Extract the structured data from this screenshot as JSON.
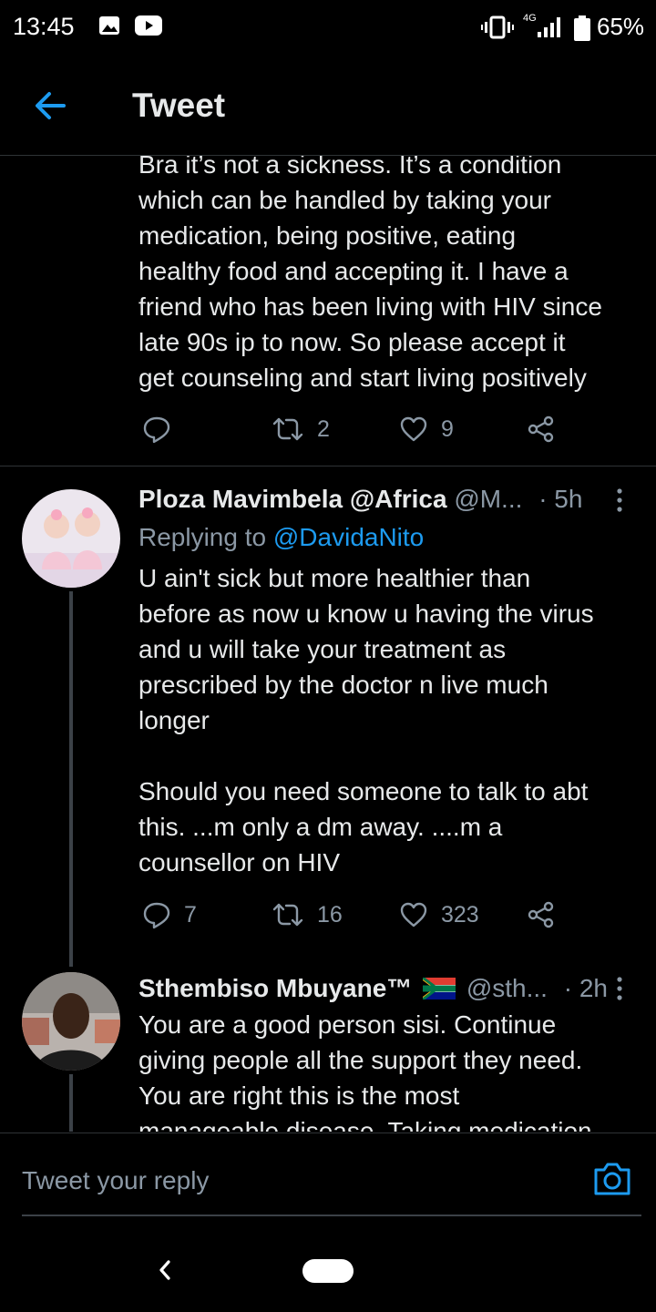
{
  "status_bar": {
    "time": "13:45",
    "network": "4G",
    "battery": "65%",
    "icons": [
      "gallery-icon",
      "youtube-icon",
      "vibrate-icon",
      "signal-icon",
      "battery-icon"
    ]
  },
  "header": {
    "title": "Tweet",
    "back_icon": "arrow-left-icon"
  },
  "tweets": [
    {
      "text": "Bra it’s not a sickness. It’s a condition\nwhich can be handled by taking your\nmedication, being positive, eating\nhealthy food and accepting it. I have a\nfriend who has been living with HIV since\nlate 90s ip to now. So please accept it\nget counseling and start living positively",
      "replies": "",
      "retweets": "2",
      "likes": "9"
    },
    {
      "name": "Ploza Mavimbela @Africa",
      "handle": "@M...",
      "time": "· 5h",
      "replying_label": "Replying to",
      "replying_to": "@DavidaNito",
      "text": "U ain't sick but more healthier than\nbefore as now u know u having the virus\nand u will take your treatment as\nprescribed by the doctor n live much\nlonger\n\nShould you need someone to talk to abt\nthis. ...m only a dm away. ....m a\ncounsellor on HIV",
      "replies": "7",
      "retweets": "16",
      "likes": "323"
    },
    {
      "name": "Sthembiso Mbuyane™",
      "handle": "@sth...",
      "time": "· 2h",
      "text": "You are a good person sisi. Continue\ngiving people all the support they need.\nYou are right this is the most\nmanageable disease. Taking medication"
    }
  ],
  "reply": {
    "placeholder": "Tweet your reply",
    "camera_icon": "camera-icon"
  },
  "colors": {
    "background": "#000000",
    "accent": "#1d9bf0",
    "muted": "#8b98a5",
    "divider": "#2f3336"
  }
}
